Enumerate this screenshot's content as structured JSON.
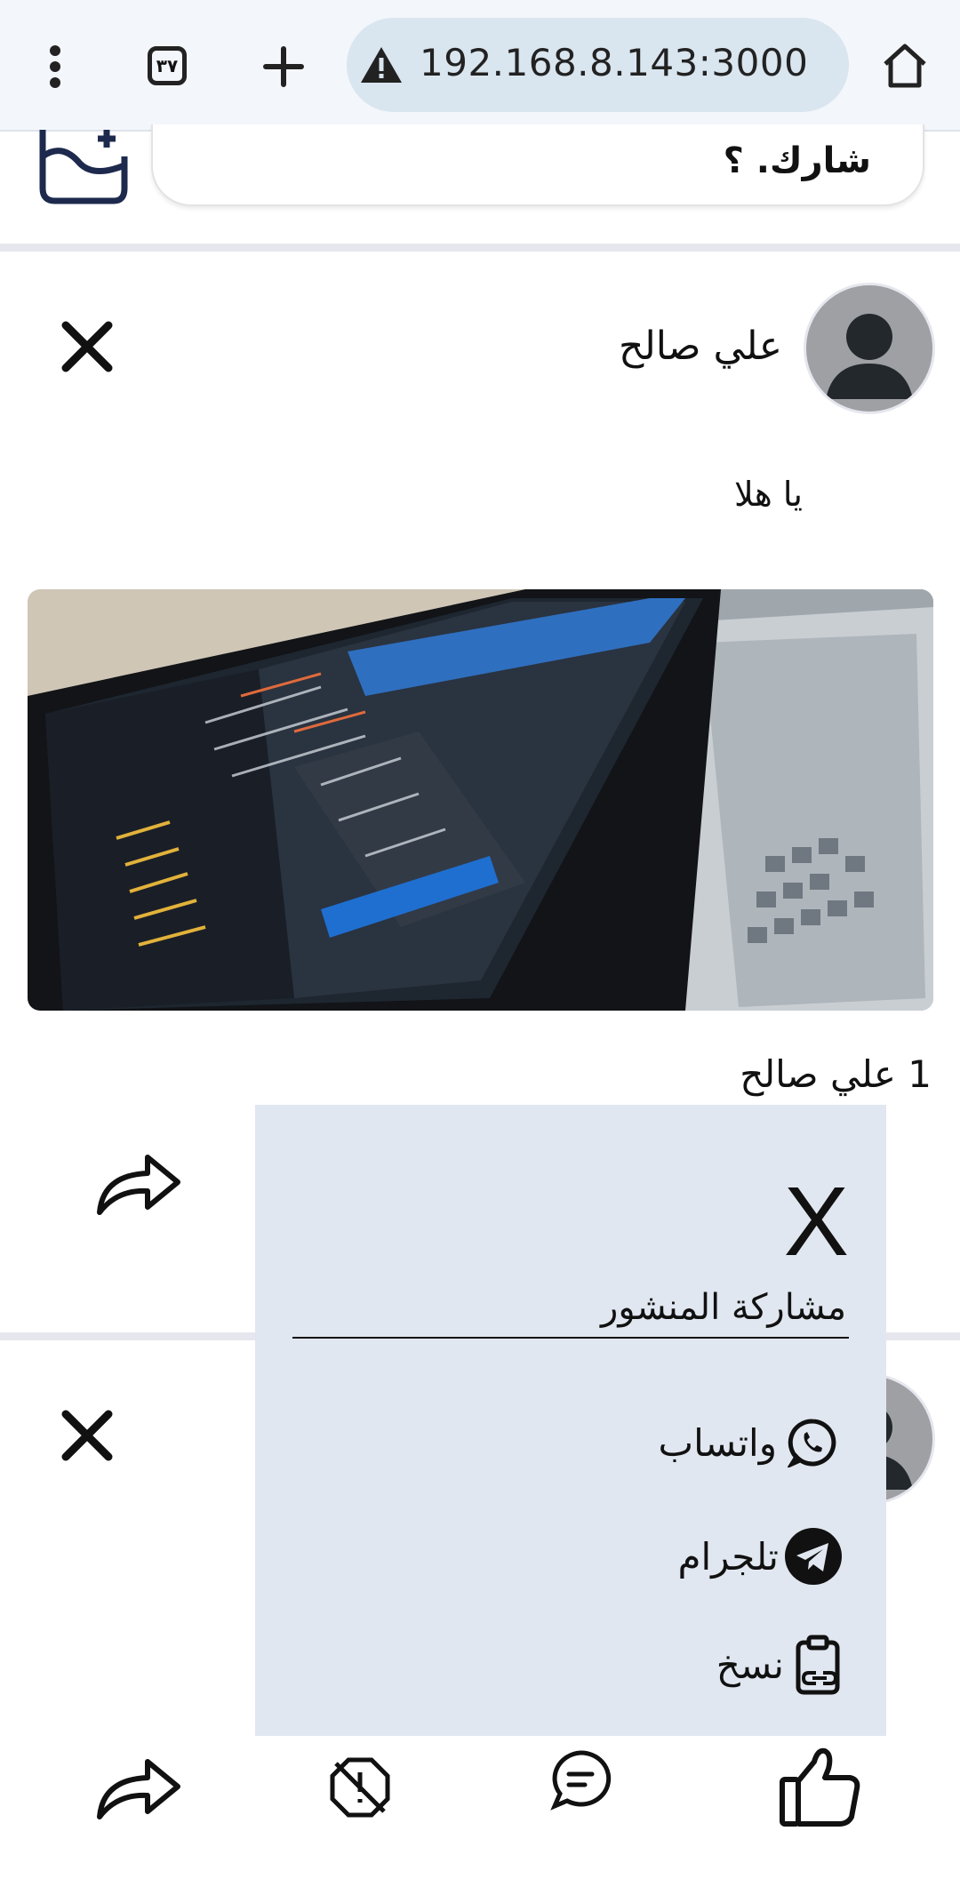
{
  "browser": {
    "url": "192.168.8.143:3000",
    "tab_count": "٣٧",
    "icons": [
      "menu-dots-icon",
      "tabs-icon",
      "new-tab-icon",
      "warning-icon",
      "home-icon"
    ]
  },
  "composer": {
    "placeholder": "شارك. ؟"
  },
  "post": {
    "author": "علي صالح",
    "text": "يا هلا",
    "likes": "1 علي صالح"
  },
  "share_popup": {
    "close_label": "X",
    "title": "مشاركة المنشور",
    "items": [
      {
        "label": "واتساب",
        "icon": "whatsapp-icon"
      },
      {
        "label": "تلجرام",
        "icon": "telegram-icon"
      },
      {
        "label": "نسخ",
        "icon": "copy-link-icon"
      }
    ]
  },
  "bottom_actions": [
    "share-icon",
    "report-icon",
    "comment-icon",
    "like-icon"
  ]
}
